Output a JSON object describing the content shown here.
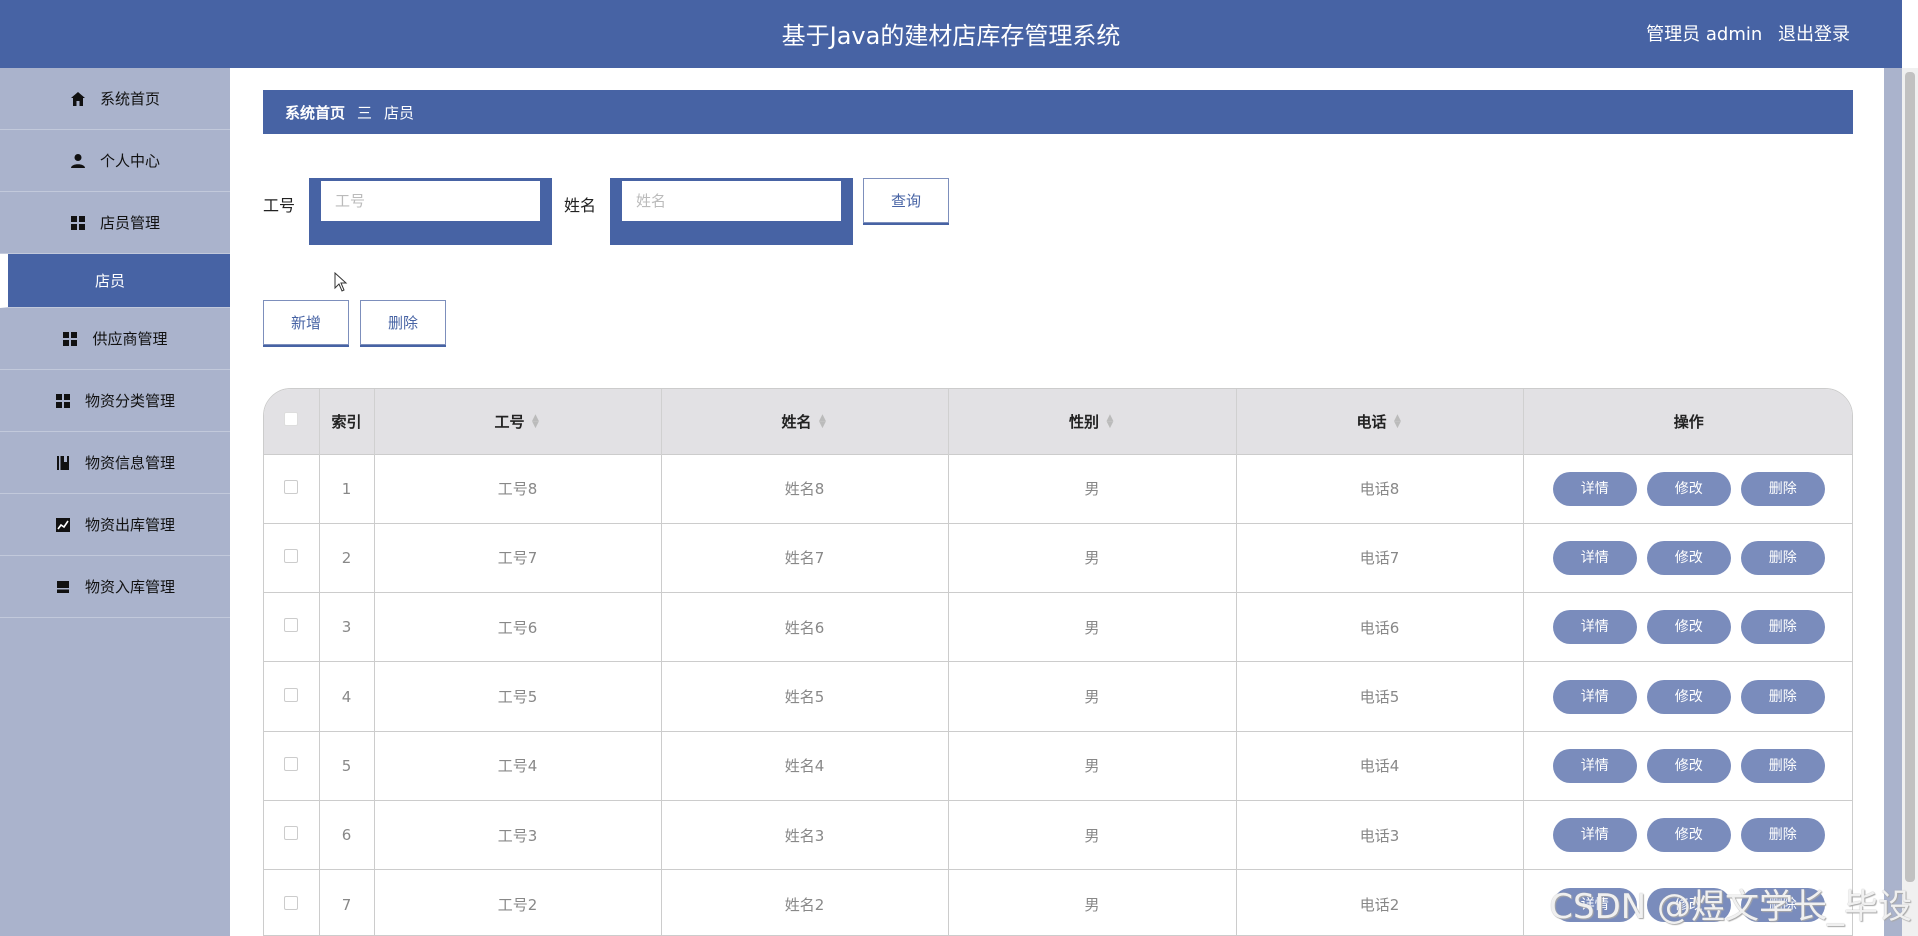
{
  "header": {
    "title": "基于Java的建材店库存管理系统",
    "user_label": "管理员 admin",
    "logout": "退出登录"
  },
  "sidebar": {
    "items": [
      {
        "label": "系统首页",
        "icon": "home-icon"
      },
      {
        "label": "个人中心",
        "icon": "user-icon"
      },
      {
        "label": "店员管理",
        "icon": "grid-icon"
      },
      {
        "label": "店员",
        "icon": ""
      },
      {
        "label": "供应商管理",
        "icon": "grid-icon"
      },
      {
        "label": "物资分类管理",
        "icon": "grid-icon"
      },
      {
        "label": "物资信息管理",
        "icon": "book-icon"
      },
      {
        "label": "物资出库管理",
        "icon": "chart-icon"
      },
      {
        "label": "物资入库管理",
        "icon": "inbox-icon"
      }
    ]
  },
  "breadcrumb": {
    "home": "系统首页",
    "sep": "三",
    "current": "店员"
  },
  "search": {
    "id_label": "工号",
    "id_placeholder": "工号",
    "name_label": "姓名",
    "name_placeholder": "姓名",
    "query_button": "查询"
  },
  "actions": {
    "add": "新增",
    "delete": "删除"
  },
  "table": {
    "headers": {
      "index": "索引",
      "id": "工号",
      "name": "姓名",
      "gender": "性别",
      "phone": "电话",
      "ops": "操作"
    },
    "ops": {
      "detail": "详情",
      "edit": "修改",
      "delete": "删除"
    },
    "rows": [
      {
        "index": "1",
        "id": "工号8",
        "name": "姓名8",
        "gender": "男",
        "phone": "电话8"
      },
      {
        "index": "2",
        "id": "工号7",
        "name": "姓名7",
        "gender": "男",
        "phone": "电话7"
      },
      {
        "index": "3",
        "id": "工号6",
        "name": "姓名6",
        "gender": "男",
        "phone": "电话6"
      },
      {
        "index": "4",
        "id": "工号5",
        "name": "姓名5",
        "gender": "男",
        "phone": "电话5"
      },
      {
        "index": "5",
        "id": "工号4",
        "name": "姓名4",
        "gender": "男",
        "phone": "电话4"
      },
      {
        "index": "6",
        "id": "工号3",
        "name": "姓名3",
        "gender": "男",
        "phone": "电话3"
      },
      {
        "index": "7",
        "id": "工号2",
        "name": "姓名2",
        "gender": "男",
        "phone": "电话2"
      }
    ]
  },
  "watermark": "CSDN @煜文学长_毕设",
  "colors": {
    "primary": "#4763a4",
    "sidebar": "#aab3cc",
    "op_button": "#7a8cbc",
    "table_header": "#e2e1e4"
  }
}
